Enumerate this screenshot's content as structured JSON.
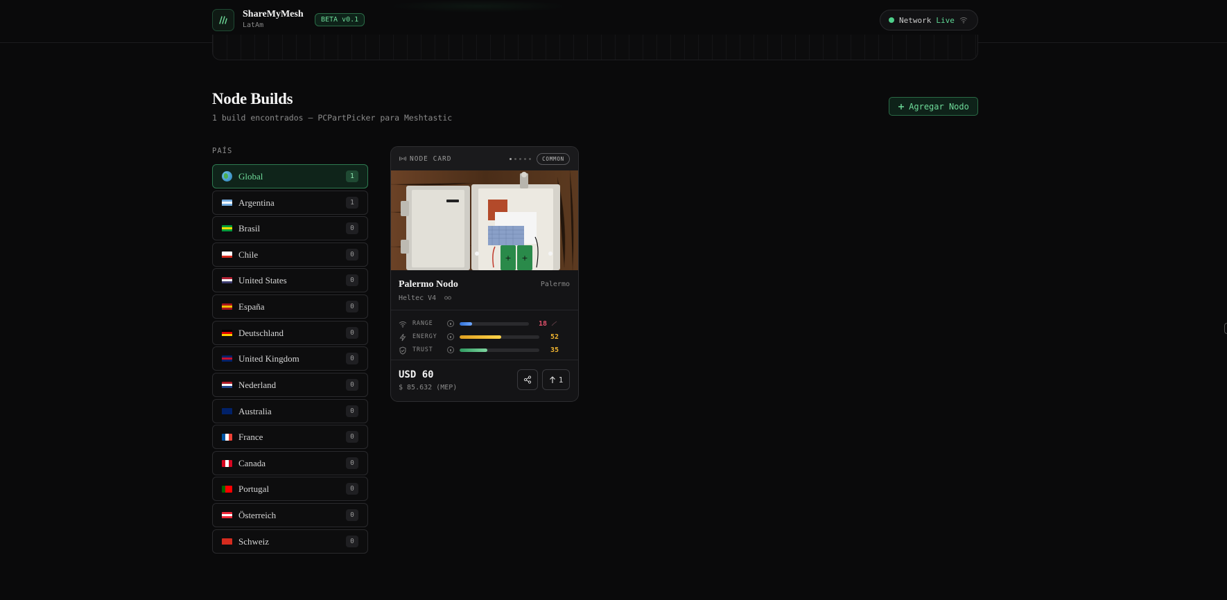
{
  "header": {
    "brand_name": "ShareMyMesh",
    "brand_sub": "LatAm",
    "beta_label": "BETA v0.1",
    "network_prefix": "Network",
    "network_status": "Live"
  },
  "main": {
    "title": "Node Builds",
    "subtitle": "1 build encontrados — PCPartPicker para Meshtastic",
    "add_button_label": "Agregar Nodo"
  },
  "sidebar": {
    "section_label": "PAÍS",
    "countries": [
      {
        "name": "Global",
        "count": "1",
        "active": true,
        "flag": "globe"
      },
      {
        "name": "Argentina",
        "count": "1",
        "flag": "ar"
      },
      {
        "name": "Brasil",
        "count": "0",
        "flag": "br"
      },
      {
        "name": "Chile",
        "count": "0",
        "flag": "cl"
      },
      {
        "name": "United States",
        "count": "0",
        "flag": "us"
      },
      {
        "name": "España",
        "count": "0",
        "flag": "es"
      },
      {
        "name": "Deutschland",
        "count": "0",
        "flag": "de"
      },
      {
        "name": "United Kingdom",
        "count": "0",
        "flag": "gb"
      },
      {
        "name": "Nederland",
        "count": "0",
        "flag": "nl"
      },
      {
        "name": "Australia",
        "count": "0",
        "flag": "au"
      },
      {
        "name": "France",
        "count": "0",
        "flag": "fr"
      },
      {
        "name": "Canada",
        "count": "0",
        "flag": "ca"
      },
      {
        "name": "Portugal",
        "count": "0",
        "flag": "pt"
      },
      {
        "name": "Österreich",
        "count": "0",
        "flag": "at"
      },
      {
        "name": "Schweiz",
        "count": "0",
        "flag": "ch"
      }
    ]
  },
  "card": {
    "header_label": "NODE CARD",
    "rarity": "COMMON",
    "title": "Palermo Nodo",
    "location": "Palermo",
    "model": "Heltec V4",
    "stats": [
      {
        "label": "RANGE",
        "value": "18",
        "level": 0.18,
        "icon": "wifi-icon",
        "color": "#e0506a"
      },
      {
        "label": "ENERGY",
        "value": "52",
        "level": 0.52,
        "icon": "bolt-icon",
        "color": "#f2b630"
      },
      {
        "label": "TRUST",
        "value": "35",
        "level": 0.35,
        "icon": "shield-icon",
        "color": "#f2b630"
      }
    ],
    "price": "USD 60",
    "price_local": "$ 85.632 (MEP)",
    "upvotes": "1"
  },
  "colors": {
    "accent": "#6fdc9a",
    "background": "#0a0a0b"
  }
}
